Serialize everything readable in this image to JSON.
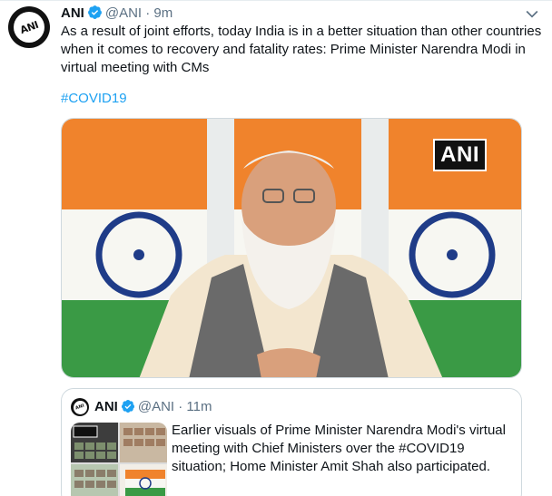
{
  "tweet": {
    "display_name": "ANI",
    "handle": "@ANI",
    "separator": "·",
    "time": "9m",
    "text": "As a result of joint efforts, today India is in a better situation than other countries when it comes to recovery and fatality rates: Prime Minister Narendra Modi in virtual meeting with CMs",
    "hashtag": "#COVID19",
    "media_badge": "ANI",
    "avatar_text": "ANI"
  },
  "quoted_tweet": {
    "display_name": "ANI",
    "handle": "@ANI",
    "separator": "·",
    "time": "11m",
    "text": "Earlier visuals of Prime Minister Narendra Modi's virtual meeting with Chief Ministers over the #COVID19 situation; Home Minister Amit Shah also participated.",
    "thumb_badge": "ANI",
    "avatar_text": "ANI"
  },
  "colors": {
    "link_blue": "#1da1f2",
    "verified_blue": "#1da1f2",
    "secondary_text": "#5b7083",
    "flag_saffron": "#f26a1b",
    "flag_green": "#2e8b3a",
    "chakra_navy": "#1f3c88"
  },
  "icons": {
    "verified": "verified-badge-icon",
    "more": "chevron-down-icon"
  }
}
